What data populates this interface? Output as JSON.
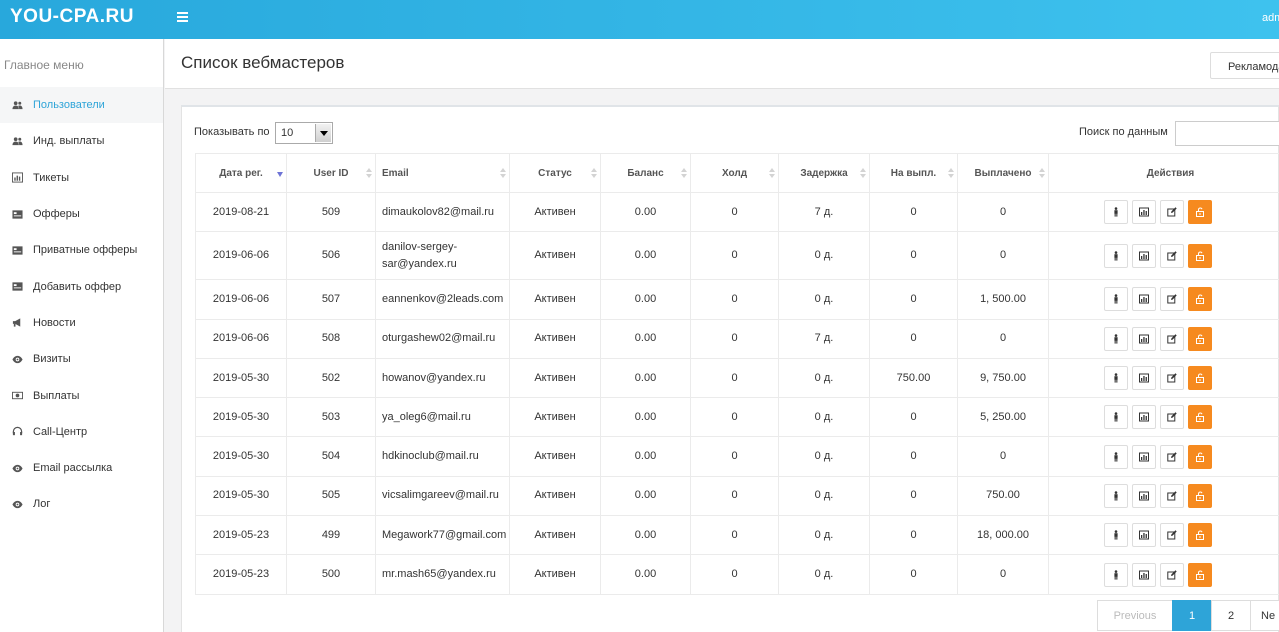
{
  "topbar": {
    "logo": "YOU-CPA.RU",
    "user": "adm"
  },
  "sidebar": {
    "title": "Главное меню",
    "items": [
      {
        "label": "Пользователи",
        "icon": "users-icon",
        "active": true
      },
      {
        "label": "Инд. выплаты",
        "icon": "users-icon",
        "active": false
      },
      {
        "label": "Тикеты",
        "icon": "chart-icon",
        "active": false
      },
      {
        "label": "Офферы",
        "icon": "card-icon",
        "active": false
      },
      {
        "label": "Приватные офферы",
        "icon": "card-icon",
        "active": false
      },
      {
        "label": "Добавить оффер",
        "icon": "card-icon",
        "active": false
      },
      {
        "label": "Новости",
        "icon": "bullhorn-icon",
        "active": false
      },
      {
        "label": "Визиты",
        "icon": "eye-icon",
        "active": false
      },
      {
        "label": "Выплаты",
        "icon": "money-icon",
        "active": false
      },
      {
        "label": "Call-Центр",
        "icon": "headset-icon",
        "active": false
      },
      {
        "label": "Email рассылка",
        "icon": "eye-icon",
        "active": false
      },
      {
        "label": "Лог",
        "icon": "eye-icon",
        "active": false
      }
    ]
  },
  "header": {
    "title": "Список вебмастеров",
    "adv_button": "Рекламода"
  },
  "controls": {
    "show_label": "Показывать по",
    "page_size": "10",
    "search_label": "Поиск по данным",
    "search_value": ""
  },
  "table": {
    "columns": [
      "Дата рег.",
      "User ID",
      "Email",
      "Статус",
      "Баланс",
      "Холд",
      "Задержка",
      "На выпл.",
      "Выплачено",
      "Действия"
    ],
    "rows": [
      [
        "2019-08-21",
        "509",
        "dimaukolov82@mail.ru",
        "Активен",
        "0.00",
        "0",
        "7 д.",
        "0",
        "0"
      ],
      [
        "2019-06-06",
        "506",
        "danilov-sergey-sar@yandex.ru",
        "Активен",
        "0.00",
        "0",
        "0 д.",
        "0",
        "0"
      ],
      [
        "2019-06-06",
        "507",
        "eannenkov@2leads.com",
        "Активен",
        "0.00",
        "0",
        "0 д.",
        "0",
        "1, 500.00"
      ],
      [
        "2019-06-06",
        "508",
        "oturgashew02@mail.ru",
        "Активен",
        "0.00",
        "0",
        "7 д.",
        "0",
        "0"
      ],
      [
        "2019-05-30",
        "502",
        "howanov@yandex.ru",
        "Активен",
        "0.00",
        "0",
        "0 д.",
        "750.00",
        "9, 750.00"
      ],
      [
        "2019-05-30",
        "503",
        "ya_oleg6@mail.ru",
        "Активен",
        "0.00",
        "0",
        "0 д.",
        "0",
        "5, 250.00"
      ],
      [
        "2019-05-30",
        "504",
        "hdkinoclub@mail.ru",
        "Активен",
        "0.00",
        "0",
        "0 д.",
        "0",
        "0"
      ],
      [
        "2019-05-30",
        "505",
        "vicsalimgareev@mail.ru",
        "Активен",
        "0.00",
        "0",
        "0 д.",
        "0",
        "750.00"
      ],
      [
        "2019-05-23",
        "499",
        "Megawork77@gmail.com",
        "Активен",
        "0.00",
        "0",
        "0 д.",
        "0",
        "18, 000.00"
      ],
      [
        "2019-05-23",
        "500",
        "mr.mash65@yandex.ru",
        "Активен",
        "0.00",
        "0",
        "0 д.",
        "0",
        "0"
      ]
    ]
  },
  "pagination": {
    "prev": "Previous",
    "pages": [
      "1",
      "2"
    ],
    "next": "Ne"
  },
  "colors": {
    "accent": "#2ea4d8",
    "orange": "#f68a1f",
    "topbar": "#35b6e6"
  }
}
